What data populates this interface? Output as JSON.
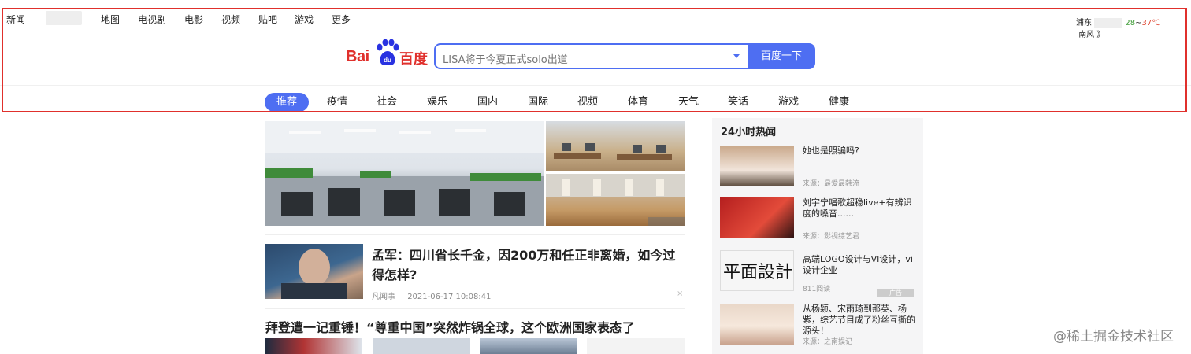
{
  "top_nav": {
    "links": [
      "新闻",
      "地图",
      "电视剧",
      "电影",
      "视频",
      "贴吧",
      "游戏",
      "更多"
    ]
  },
  "weather": {
    "city": "浦东",
    "temp_low": "28",
    "temp_sep": "~",
    "temp_high": "37℃",
    "wind": "南风 》"
  },
  "logo": {
    "text_bai": "Bai",
    "text_du": "du",
    "text_cn": "百度"
  },
  "search": {
    "placeholder": "LISA将于今夏正式solo出道",
    "button_label": "百度一下"
  },
  "categories": [
    "推荐",
    "疫情",
    "社会",
    "娱乐",
    "国内",
    "国际",
    "视频",
    "体育",
    "天气",
    "笑话",
    "游戏",
    "健康"
  ],
  "feed": {
    "article1": {
      "title": "孟军：四川省长千金，因200万和任正非离婚，如今过得怎样?",
      "source": "凡闻事",
      "time": "2021-06-17 10:08:41",
      "close": "×"
    },
    "article2": {
      "title": "拜登遭一记重锤！“尊重中国”突然炸锅全球，这个欧洲国家表态了"
    }
  },
  "hot": {
    "title": "24小时热闻",
    "items": [
      {
        "text": "她也是照骗吗?",
        "source": "来源：最爱最韩流"
      },
      {
        "text": "刘宇宁唱歌超稳live+有辨识度的嗓音......",
        "source": "来源：影视综艺君"
      },
      {
        "text": "高端LOGO设计与VI设计，vi设计企业",
        "source": "811阅读",
        "ad": "广告"
      },
      {
        "text": "从杨颖、宋雨琦到那英、杨紫，综艺节目成了粉丝互撕的源头！",
        "source": "来源：之南娱记"
      }
    ]
  },
  "watermark": "@稀土掘金技术社区",
  "colors": {
    "accent": "#4e6ef2",
    "brand_red": "#e0302c",
    "frame": "#e0302c"
  }
}
